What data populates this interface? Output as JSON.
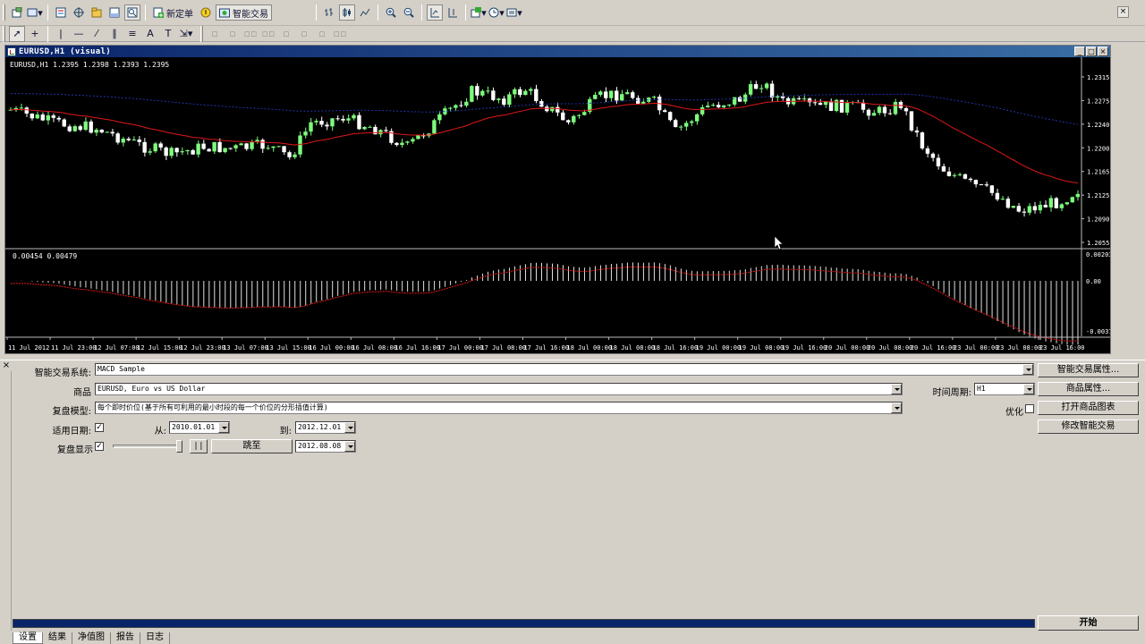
{
  "toolbar": {
    "new_order_label": "新定单",
    "expert_trading_label": "智能交易"
  },
  "chart_window": {
    "title": "EURUSD,H1  (visual)",
    "info_text": "EURUSD,H1  1.2395 1.2398 1.2393 1.2395",
    "indicator_text": "0.00454 0.00479",
    "price_ticks": [
      "1.2315",
      "1.2275",
      "1.2240",
      "1.2200",
      "1.2165",
      "1.2125",
      "1.2090",
      "1.2055"
    ],
    "indicator_ticks": [
      "0.00203",
      "0.00",
      "-0.00375"
    ],
    "time_ticks": [
      "11 Jul 2012",
      "11 Jul 23:00",
      "12 Jul 07:00",
      "12 Jul 15:00",
      "12 Jul 23:00",
      "13 Jul 07:00",
      "13 Jul 15:00",
      "16 Jul 00:00",
      "16 Jul 08:00",
      "16 Jul 16:00",
      "17 Jul 00:00",
      "17 Jul 08:00",
      "17 Jul 16:00",
      "18 Jul 00:00",
      "18 Jul 08:00",
      "18 Jul 16:00",
      "19 Jul 00:00",
      "19 Jul 08:00",
      "19 Jul 16:00",
      "20 Jul 00:00",
      "20 Jul 08:00",
      "20 Jul 16:00",
      "23 Jul 00:00",
      "23 Jul 08:00",
      "23 Jul 16:00"
    ],
    "colors": {
      "background": "#000000",
      "bull": "#7cfc7c",
      "bear": "#ffffff",
      "ma": "#e01818",
      "ma_slow": "#2233aa",
      "macd_hist": "#e0e0e0",
      "macd_signal": "#e01818"
    }
  },
  "tester": {
    "expert_label": "智能交易系统:",
    "expert_value": "MACD Sample",
    "expert_props_button": "智能交易属性...",
    "symbol_label": "商品",
    "symbol_value": "EURUSD, Euro vs US Dollar",
    "symbol_props_button": "商品属性...",
    "period_label": "时间周期:",
    "period_value": "H1",
    "model_label": "复盘模型:",
    "model_value": "每个即时价位(基于所有可利用的最小时段的每一个价位的分形插值计算)",
    "optimize_label": "优化",
    "open_chart_button": "打开商品图表",
    "modify_expert_button": "修改智能交易",
    "use_date_label": "适用日期:",
    "use_date_checked": "✓",
    "from_label": "从:",
    "from_value": "2010.01.01",
    "to_label": "到:",
    "to_value": "2012.12.01",
    "visual_label": "复盘显示",
    "visual_checked": "✓",
    "pause_label": "| |",
    "skip_to_button": "跳至",
    "skip_to_value": "2012.08.08",
    "start_button": "开始",
    "progress": 1.0,
    "tabs": [
      "设置",
      "结果",
      "净值图",
      "报告",
      "日志"
    ]
  }
}
